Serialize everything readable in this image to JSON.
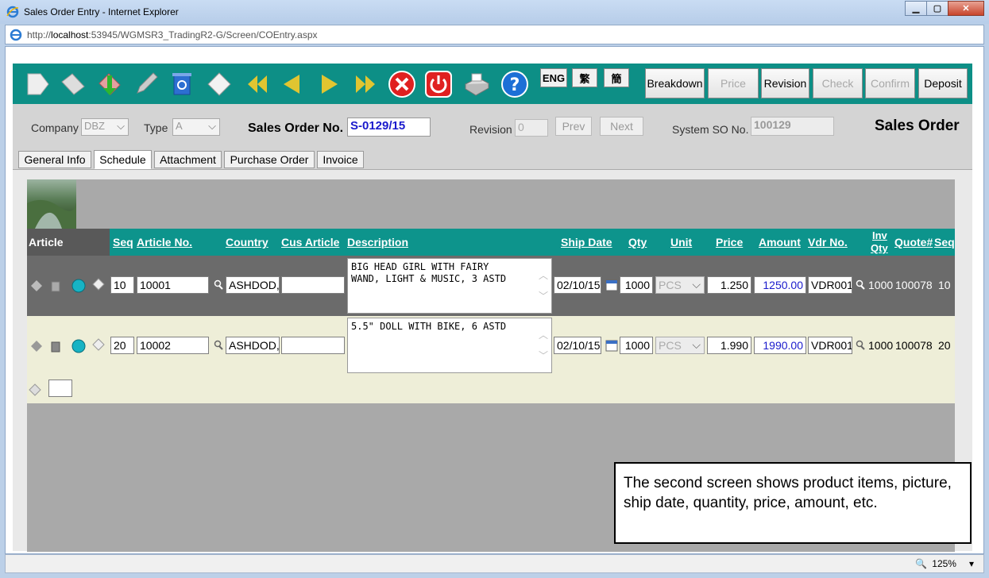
{
  "window": {
    "title": "Sales Order Entry - Internet Explorer",
    "url_prefix": "http://",
    "url_host": "localhost",
    "url_rest": ":53945/WGMSR3_TradingR2-G/Screen/COEntry.aspx",
    "zoom": "125%"
  },
  "toolbar": {
    "lang_eng": "ENG",
    "lang_trad": "繁",
    "lang_simp": "簡",
    "buttons": {
      "breakdown": "Breakdown",
      "price": "Price",
      "revision": "Revision",
      "check": "Check",
      "confirm": "Confirm",
      "deposit": "Deposit"
    }
  },
  "header": {
    "company_label": "Company",
    "company_value": "DBZ",
    "type_label": "Type",
    "type_value": "A",
    "so_label": "Sales Order No.",
    "so_value": "S-0129/15",
    "revision_label": "Revision",
    "revision_value": "0",
    "prev": "Prev",
    "next": "Next",
    "system_so_label": "System SO No.",
    "system_so_value": "100129",
    "page_title": "Sales Order"
  },
  "tabs": [
    "General Info",
    "Schedule",
    "Attachment",
    "Purchase Order",
    "Invoice"
  ],
  "grid": {
    "article_header": "Article",
    "columns": {
      "seq": "Seq",
      "article_no": "Article No.",
      "country": "Country",
      "cus_article": "Cus Article",
      "description": "Description",
      "ship_date": "Ship Date",
      "qty": "Qty",
      "unit": "Unit",
      "price": "Price",
      "amount": "Amount",
      "vdr_no": "Vdr No.",
      "inv_qty_1": "Inv",
      "inv_qty_2": "Qty",
      "quote": "Quote#",
      "seq2": "Seq"
    },
    "rows": [
      {
        "seq": "10",
        "article_no": "10001",
        "country": "ASHDOD,",
        "cus_article": "",
        "description": "BIG HEAD GIRL WITH FAIRY\nWAND, LIGHT & MUSIC, 3 ASTD",
        "ship_date": "02/10/15",
        "qty": "1000",
        "unit": "PCS",
        "price": "1.250",
        "amount": "1250.00",
        "vdr_no": "VDR001",
        "inv_qty": "1000",
        "quote": "100078",
        "seq2": "10"
      },
      {
        "seq": "20",
        "article_no": "10002",
        "country": "ASHDOD,",
        "cus_article": "",
        "description": "5.5\" DOLL WITH BIKE, 6 ASTD",
        "ship_date": "02/10/15",
        "qty": "1000",
        "unit": "PCS",
        "price": "1.990",
        "amount": "1990.00",
        "vdr_no": "VDR001",
        "inv_qty": "1000",
        "quote": "100078",
        "seq2": "20"
      }
    ]
  },
  "note": "The second screen shows product items, picture, ship date, quantity, price, amount, etc."
}
